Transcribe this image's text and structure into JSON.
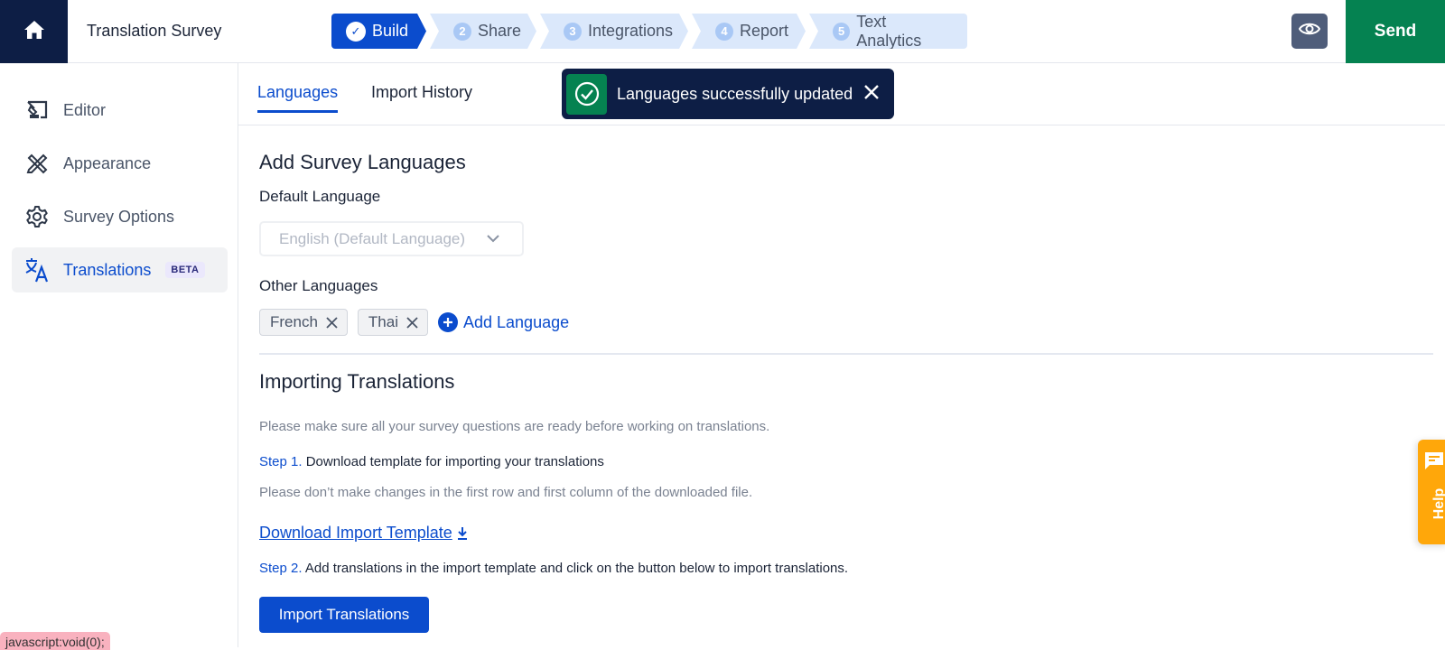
{
  "header": {
    "title": "Translation Survey",
    "steps": [
      {
        "num": "✓",
        "label": "Build",
        "active": true
      },
      {
        "num": "2",
        "label": "Share",
        "active": false
      },
      {
        "num": "3",
        "label": "Integrations",
        "active": false
      },
      {
        "num": "4",
        "label": "Report",
        "active": false
      },
      {
        "num": "5",
        "label": "Text Analytics",
        "active": false
      }
    ],
    "preview_icon": "eye-icon",
    "send_label": "Send"
  },
  "sidebar": {
    "items": [
      {
        "label": "Editor",
        "icon": "editor-icon"
      },
      {
        "label": "Appearance",
        "icon": "appearance-icon"
      },
      {
        "label": "Survey Options",
        "icon": "gear-icon"
      },
      {
        "label": "Translations",
        "icon": "translate-icon",
        "badge": "BETA",
        "active": true
      }
    ]
  },
  "tabs": [
    {
      "label": "Languages",
      "active": true
    },
    {
      "label": "Import History",
      "active": false
    }
  ],
  "toast": {
    "message": "Languages successfully updated",
    "icon": "check-circle-icon"
  },
  "languages": {
    "heading": "Add Survey Languages",
    "default_label": "Default Language",
    "default_value": "English (Default Language)",
    "other_label": "Other Languages",
    "others": [
      "French",
      "Thai"
    ],
    "add_label": "Add Language"
  },
  "importing": {
    "heading": "Importing Translations",
    "note": "Please make sure all your survey questions are ready before working on translations.",
    "step1_label": "Step 1.",
    "step1_text": " Download template for importing your translations",
    "step1_note": "Please don’t make changes in the first row and first column of the downloaded file.",
    "download_link": "Download Import Template",
    "step2_label": "Step 2.",
    "step2_text": " Add translations in the import template and click on the button below to import translations.",
    "import_button": "Import Translations"
  },
  "help": {
    "label": "Help"
  },
  "status_bar": "javascript:void(0);",
  "colors": {
    "primary": "#0b4ccd",
    "navy": "#0d1e45",
    "send_green": "#058251",
    "help_orange": "#ffa70a"
  }
}
